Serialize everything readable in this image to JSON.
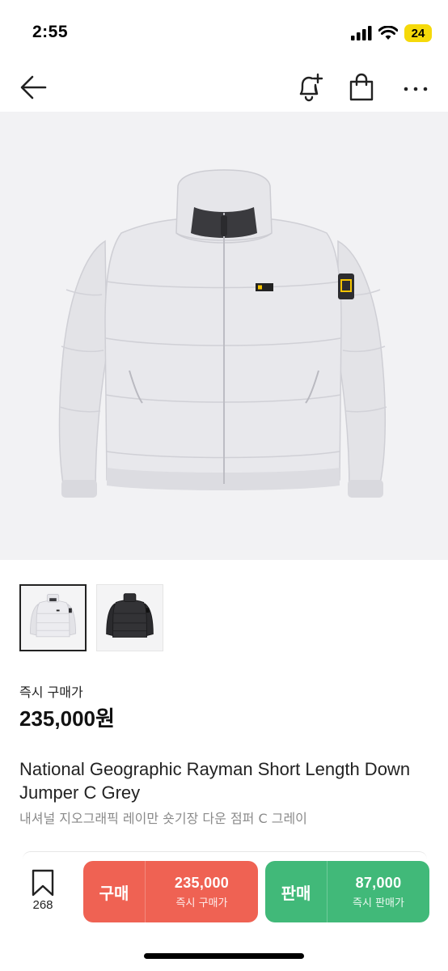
{
  "status_bar": {
    "time": "2:55",
    "battery": "24",
    "battery_color": "#f5d90a"
  },
  "nav": {
    "icons": [
      "back-arrow-icon",
      "bell-plus-icon",
      "shopping-bag-icon",
      "more-dots-icon"
    ]
  },
  "product": {
    "image_color": "light grey puffer jacket",
    "thumbnails": [
      {
        "label": "grey",
        "selected": true
      },
      {
        "label": "black",
        "selected": false
      }
    ],
    "instant_buy_label": "즉시 구매가",
    "instant_buy_price": "235,000원",
    "name_en": "National Geographic Rayman Short Length Down Jumper C Grey",
    "name_ko": "내셔널 지오그래픽 레이만 숏기장 다운 점퍼 C 그레이"
  },
  "bottom_bar": {
    "wish_count": "268",
    "buy": {
      "type": "구매",
      "price": "235,000",
      "sub": "즉시 구매가",
      "color": "#ef6253"
    },
    "sell": {
      "type": "판매",
      "price": "87,000",
      "sub": "즉시 판매가",
      "color": "#41b979"
    }
  }
}
